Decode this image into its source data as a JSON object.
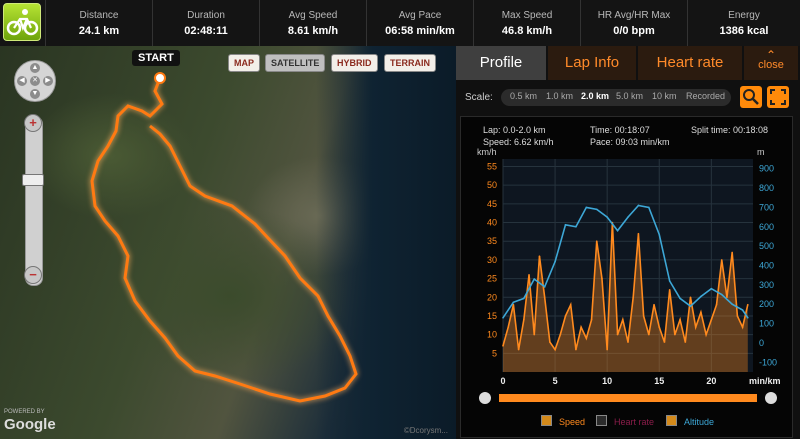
{
  "stats": [
    {
      "label": "Distance",
      "value": "24.1 km"
    },
    {
      "label": "Duration",
      "value": "02:48:11"
    },
    {
      "label": "Avg Speed",
      "value": "8.61 km/h"
    },
    {
      "label": "Avg Pace",
      "value": "06:58 min/km"
    },
    {
      "label": "Max Speed",
      "value": "46.8 km/h"
    },
    {
      "label": "HR Avg/HR Max",
      "value": "0/0 bpm"
    },
    {
      "label": "Energy",
      "value": "1386 kcal"
    }
  ],
  "map": {
    "buttons": [
      "MAP",
      "SATELLITE",
      "HYBRID",
      "TERRAIN"
    ],
    "active_button": "SATELLITE",
    "start_label": "START",
    "powered_by": "POWERED BY",
    "google": "Google",
    "copyright": "©Dcorysm..."
  },
  "tabs": [
    {
      "label": "Profile",
      "active": true
    },
    {
      "label": "Lap Info",
      "active": false
    },
    {
      "label": "Heart rate",
      "active": false
    }
  ],
  "close_label": "close",
  "scale": {
    "label": "Scale:",
    "options": [
      "0.5 km",
      "1.0 km",
      "2.0 km",
      "5.0 km",
      "10 km",
      "Recorded"
    ],
    "selected": "2.0 km"
  },
  "info": {
    "lap": "Lap: 0.0-2.0 km",
    "speed": "Speed: 6.62 km/h",
    "time": "Time: 00:18:07",
    "pace": "Pace: 09:03 min/km",
    "split": "Split time: 00:18:08"
  },
  "axis_units": {
    "left": "km/h",
    "right": "m",
    "bottom": "min/km"
  },
  "legend": [
    {
      "label": "Speed",
      "checked": true,
      "color": "#ff8a1e"
    },
    {
      "label": "Heart rate",
      "checked": false,
      "color": "#8b1d4a"
    },
    {
      "label": "Altitude",
      "checked": true,
      "color": "#3da7d6"
    }
  ],
  "chart_data": {
    "type": "area",
    "x_ticks": [
      0,
      5,
      10,
      15,
      20
    ],
    "y_left_ticks": [
      5,
      10,
      15,
      20,
      25,
      30,
      35,
      40,
      45,
      50,
      55
    ],
    "y_right_ticks": [
      -100,
      0,
      100,
      200,
      300,
      400,
      500,
      600,
      700,
      800,
      900
    ],
    "ylim_left": [
      0,
      57
    ],
    "ylim_right": [
      -150,
      950
    ],
    "xlim": [
      0,
      24
    ],
    "series": [
      {
        "name": "Speed",
        "axis": "left",
        "color": "#ff8a1e",
        "x": [
          0,
          0.5,
          1,
          1.5,
          2,
          2.5,
          3,
          3.5,
          4,
          4.5,
          5,
          5.5,
          6,
          6.5,
          7,
          7.5,
          8,
          8.5,
          9,
          9.5,
          10,
          10.5,
          11,
          11.5,
          12,
          12.5,
          13,
          13.5,
          14,
          14.5,
          15,
          15.5,
          16,
          16.5,
          17,
          17.5,
          18,
          18.5,
          19,
          19.5,
          20,
          20.5,
          21,
          21.5,
          22,
          22.5,
          23,
          23.5
        ],
        "values": [
          7,
          12,
          18,
          6,
          14,
          26,
          10,
          31,
          20,
          8,
          6,
          10,
          15,
          18,
          6,
          12,
          9,
          14,
          35,
          25,
          6,
          40,
          10,
          14,
          8,
          20,
          37,
          15,
          10,
          18,
          12,
          8,
          22,
          10,
          14,
          8,
          20,
          12,
          16,
          10,
          14,
          18,
          30,
          20,
          32,
          15,
          12,
          18
        ]
      },
      {
        "name": "Altitude",
        "axis": "right",
        "color": "#3da7d6",
        "x": [
          0,
          1,
          2,
          3,
          4,
          5,
          6,
          7,
          8,
          9,
          10,
          11,
          12,
          13,
          14,
          15,
          16,
          17,
          18,
          19,
          20,
          21,
          22,
          23,
          23.5
        ],
        "values": [
          130,
          210,
          230,
          330,
          290,
          420,
          610,
          600,
          700,
          690,
          650,
          580,
          650,
          710,
          700,
          560,
          320,
          230,
          190,
          240,
          280,
          250,
          200,
          170,
          130
        ]
      }
    ]
  }
}
